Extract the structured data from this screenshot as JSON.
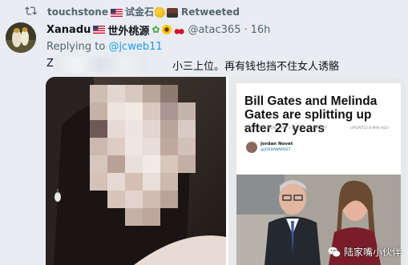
{
  "retweet": {
    "user": "touchstone",
    "user_suffix": "试金石",
    "action": "Retweeted"
  },
  "tweet": {
    "author_name": "Xanadu",
    "author_name_suffix": "世外桃源",
    "handle": "@atac365",
    "separator": "·",
    "time": "16h",
    "replying_to_label": "Replying to",
    "replying_to_handle": "@jcweb11",
    "text_prefix": "Z",
    "text_suffix": "小三上位。再有钱也挡不住女人诱骼"
  },
  "article_card": {
    "title": "Bill Gates and Melinda Gates are splitting up after 27 years",
    "published": "PUBLISHED MON, MAY 3 2021·4:31 PM EDT",
    "updated": "UPDATED 8 MIN AGO",
    "author": "Jordan Novet",
    "author_handle": "@JORDANNOVET"
  },
  "watermark": {
    "text": "陆家嘴小伙伴"
  },
  "colors": {
    "background": "#e9edf2",
    "link": "#1d9bf0",
    "secondary_text": "#536471"
  },
  "icons": [
    "retweet-icon",
    "us-flag-icon",
    "flexed-bicep-icon",
    "steam-locomotive-icon",
    "four-leaf-clover-icon",
    "sunflower-icon",
    "cherries-icon",
    "wechat-icon"
  ]
}
